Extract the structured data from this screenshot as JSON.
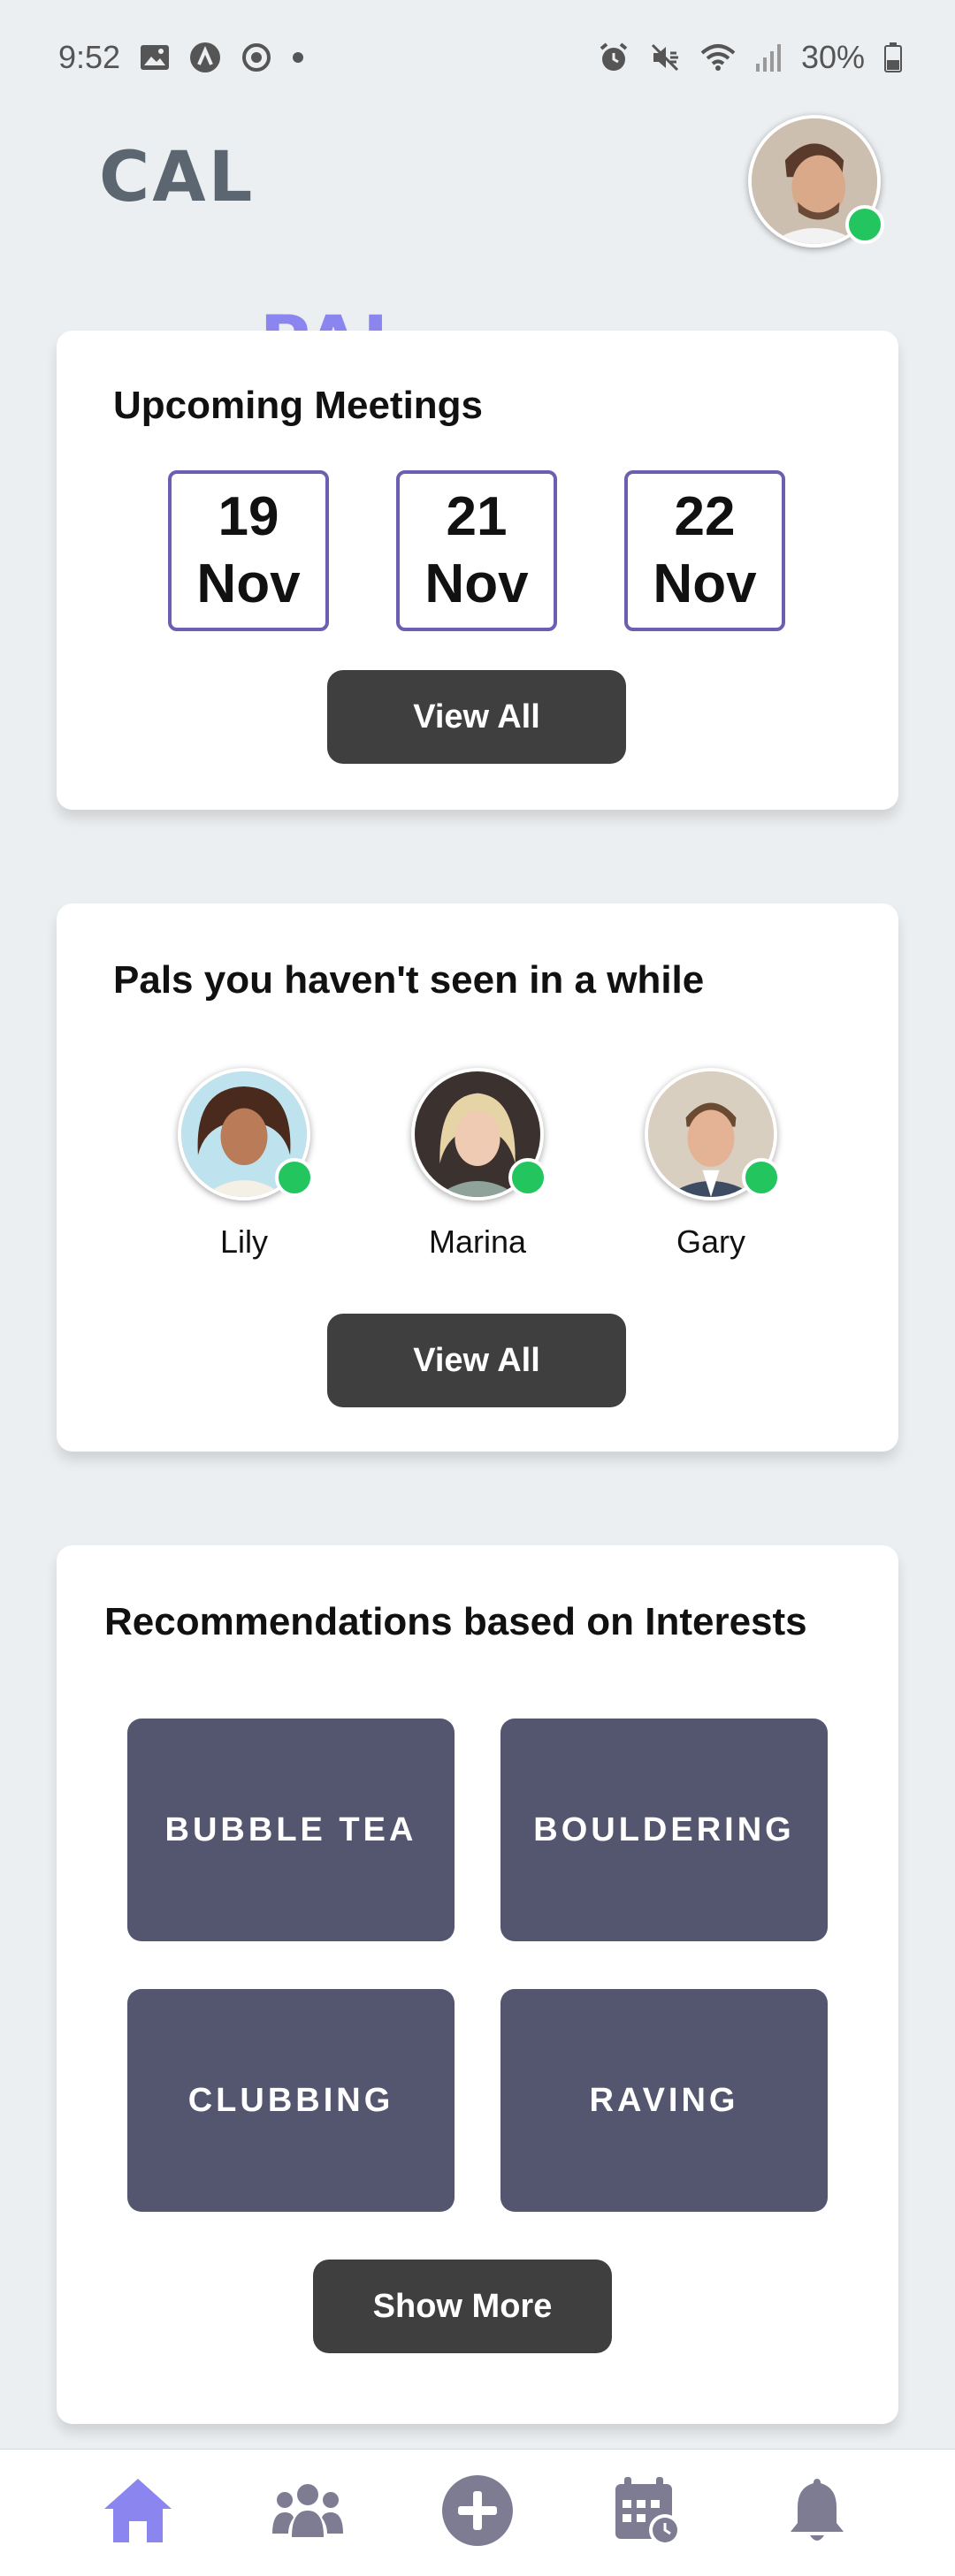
{
  "status_bar": {
    "time": "9:52",
    "battery": "30%",
    "left_icons": [
      "image-icon",
      "a-circle-icon",
      "sync-icon",
      "dot-icon"
    ],
    "right_icons": [
      "alarm-icon",
      "mute-icon",
      "wifi-icon",
      "signal-icon",
      "battery-icon"
    ]
  },
  "header": {
    "logo_part1": "CAL",
    "logo_part2": "PAL",
    "profile_status": "online"
  },
  "meetings": {
    "title": "Upcoming Meetings",
    "dates": [
      {
        "day": "19",
        "month": "Nov"
      },
      {
        "day": "21",
        "month": "Nov"
      },
      {
        "day": "22",
        "month": "Nov"
      }
    ],
    "button": "View All"
  },
  "pals": {
    "title": "Pals you haven't seen in a while",
    "people": [
      {
        "name": "Lily",
        "status": "online"
      },
      {
        "name": "Marina",
        "status": "online"
      },
      {
        "name": "Gary",
        "status": "online"
      }
    ],
    "button": "View All"
  },
  "recommendations": {
    "title": "Recommendations based on Interests",
    "items": [
      "BUBBLE TEA",
      "BOULDERING",
      "CLUBBING",
      "RAVING"
    ],
    "button": "Show More"
  },
  "bottom_nav": {
    "items": [
      "home-icon",
      "friends-icon",
      "add-icon",
      "calendar-icon",
      "bell-icon"
    ],
    "active": "home-icon"
  },
  "colors": {
    "background": "#eceff1",
    "accent": "#8b85f0",
    "tile": "#545670",
    "button": "#3f3f3f",
    "online": "#22c55e",
    "nav_active": "#8b85f0",
    "nav_inactive": "#7d7c93"
  }
}
